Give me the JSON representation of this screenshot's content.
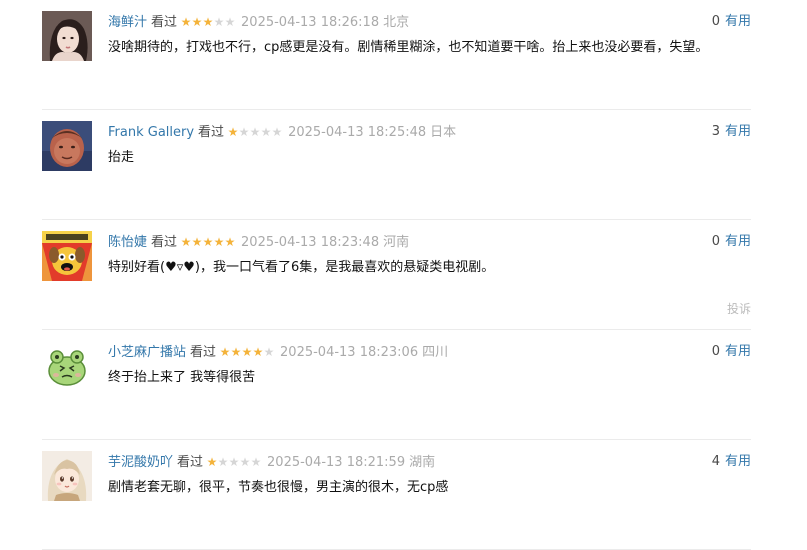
{
  "comments": [
    {
      "author": "海鲜汁",
      "status": "看过",
      "rating": 3,
      "time": "2025-04-13 18:26:18",
      "location": "北京",
      "votes": "0",
      "vote_label": "有用",
      "content": "没啥期待的，打戏也不行，cp感更是没有。剧情稀里糊涂，也不知道要干啥。抬上来也没必要看，失望。",
      "avatar_icon": "girl-portrait-avatar"
    },
    {
      "author": "Frank Gallery",
      "status": "看过",
      "rating": 1,
      "time": "2025-04-13 18:25:48",
      "location": "日本",
      "votes": "3",
      "vote_label": "有用",
      "content": "抬走",
      "avatar_icon": "cartoon-face-avatar"
    },
    {
      "author": "陈怡婕",
      "status": "看过",
      "rating": 5,
      "time": "2025-04-13 18:23:48",
      "location": "河南",
      "votes": "0",
      "vote_label": "有用",
      "content": "特别好看(♥▿♥)，我一口气看了6集，是我最喜欢的悬疑类电视剧。",
      "report": "投诉",
      "avatar_icon": "cartoon-dog-avatar"
    },
    {
      "author": "小芝麻广播站",
      "status": "看过",
      "rating": 4,
      "time": "2025-04-13 18:23:06",
      "location": "四川",
      "votes": "0",
      "vote_label": "有用",
      "content": "终于抬上来了 我等得很苦",
      "avatar_icon": "green-frog-avatar"
    },
    {
      "author": "芋泥酸奶吖",
      "status": "看过",
      "rating": 1,
      "time": "2025-04-13 18:21:59",
      "location": "湖南",
      "votes": "4",
      "vote_label": "有用",
      "content": "剧情老套无聊，很平，节奏也很慢，男主演的很木，无cp感",
      "avatar_icon": "anime-girl-avatar"
    }
  ],
  "colors": {
    "link": "#3377aa",
    "star_on": "#f4b33b",
    "star_off": "#d6d6d6",
    "muted": "#aaaaaa",
    "divider": "#ebebeb"
  }
}
